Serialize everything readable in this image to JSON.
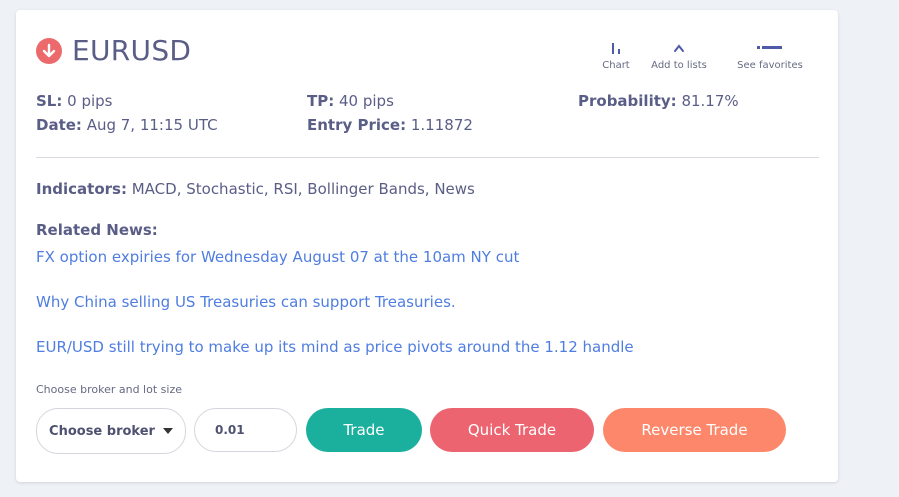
{
  "signal": {
    "symbol": "EURUSD",
    "direction_icon": "arrow-down-circle-icon",
    "direction_color": "#ec6a6c"
  },
  "actions": [
    {
      "label": "Chart",
      "icon": "chart-icon"
    },
    {
      "label": "Add to lists",
      "icon": "caret-up-icon"
    },
    {
      "label": "See favorites",
      "icon": "list-icon"
    }
  ],
  "stats": {
    "sl_label": "SL:",
    "sl_value": "0 pips",
    "tp_label": "TP:",
    "tp_value": "40 pips",
    "probability_label": "Probability:",
    "probability_value": "81.17%",
    "date_label": "Date:",
    "date_value": "Aug 7, 11:15 UTC",
    "entry_label": "Entry Price:",
    "entry_value": "1.11872"
  },
  "indicators": {
    "label": "Indicators:",
    "value": "MACD, Stochastic, RSI, Bollinger Bands, News"
  },
  "related_news": {
    "title": "Related News:",
    "items": [
      "FX option expiries for Wednesday August 07 at the 10am NY cut",
      "Why China selling US Treasuries can support Treasuries.",
      "EUR/USD still trying to make up its mind as price pivots around the 1.12 handle"
    ]
  },
  "order": {
    "choose_label": "Choose broker and lot size",
    "broker_select": "Choose broker",
    "lot_value": "0.01",
    "trade_label": "Trade",
    "quick_trade_label": "Quick Trade",
    "reverse_trade_label": "Reverse Trade"
  },
  "colors": {
    "trade": "#1bb09d",
    "quick_trade": "#ec6470",
    "reverse_trade": "#fd876a",
    "link": "#4f7de0",
    "text": "#5a5e86"
  }
}
